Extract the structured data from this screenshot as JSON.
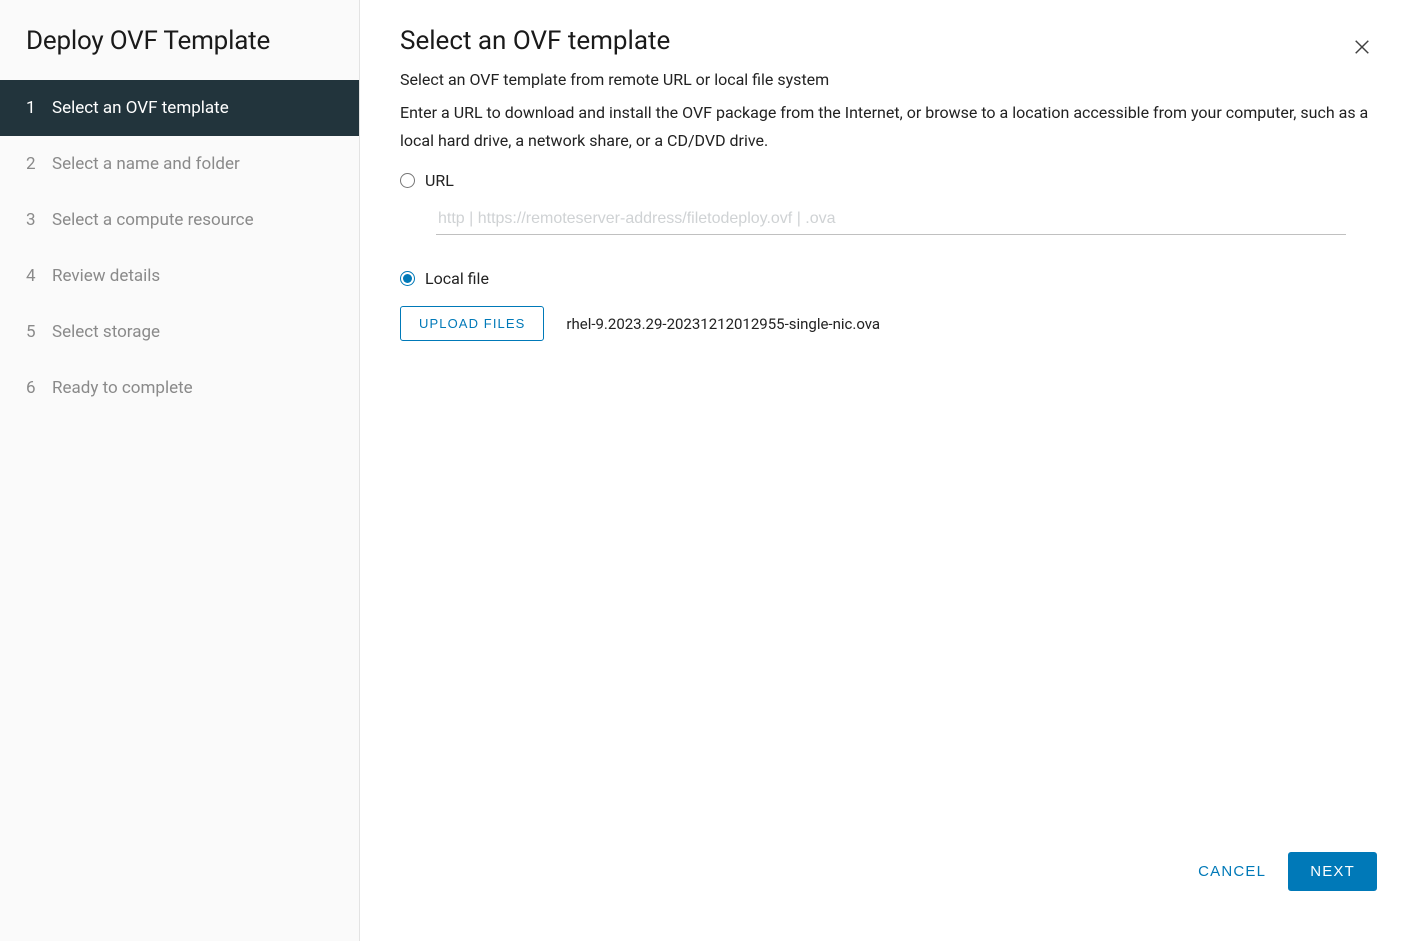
{
  "sidebar": {
    "title": "Deploy OVF Template",
    "steps": [
      {
        "num": "1",
        "label": "Select an OVF template",
        "active": true
      },
      {
        "num": "2",
        "label": "Select a name and folder",
        "active": false
      },
      {
        "num": "3",
        "label": "Select a compute resource",
        "active": false
      },
      {
        "num": "4",
        "label": "Review details",
        "active": false
      },
      {
        "num": "5",
        "label": "Select storage",
        "active": false
      },
      {
        "num": "6",
        "label": "Ready to complete",
        "active": false
      }
    ]
  },
  "main": {
    "title": "Select an OVF template",
    "subtitle": "Select an OVF template from remote URL or local file system",
    "description": "Enter a URL to download and install the OVF package from the Internet, or browse to a location accessible from your computer, such as a local hard drive, a network share, or a CD/DVD drive.",
    "url_option": {
      "label": "URL",
      "placeholder": "http | https://remoteserver-address/filetodeploy.ovf | .ova",
      "selected": false
    },
    "local_option": {
      "label": "Local file",
      "selected": true,
      "upload_button": "UPLOAD FILES",
      "filename": "rhel-9.2023.29-20231212012955-single-nic.ova"
    }
  },
  "footer": {
    "cancel": "CANCEL",
    "next": "NEXT"
  }
}
